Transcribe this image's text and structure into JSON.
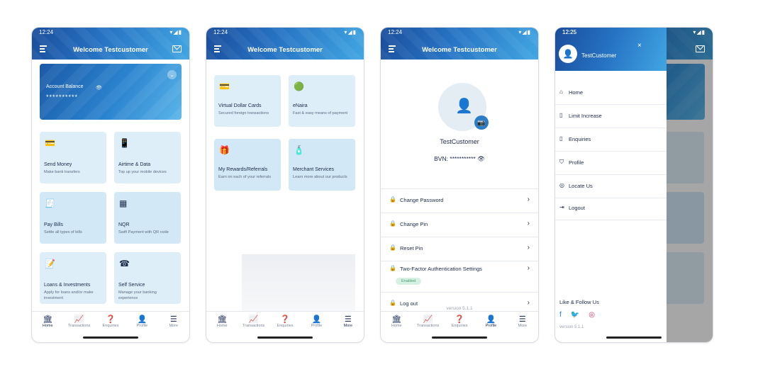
{
  "status": {
    "phone1_time": "12:24",
    "phone4_time": "12:25",
    "icons": "▾◢▮"
  },
  "header": {
    "title": "Welcome Testcustomer"
  },
  "home": {
    "balance_label": "Account Balance",
    "balance_value": "**********",
    "tiles": [
      {
        "title": "Send Money",
        "desc": "Make bank transfers",
        "icon": "wallet-icon"
      },
      {
        "title": "Airtime & Data",
        "desc": "Top up your mobile devices",
        "icon": "phone-icon"
      },
      {
        "title": "Pay Bills",
        "desc": "Settle all types of bills",
        "icon": "bill-icon"
      },
      {
        "title": "NQR",
        "desc": "Swift Payment with QR code",
        "icon": "qr-icon"
      },
      {
        "title": "Loans & Investments",
        "desc": "Apply for loans and/or make investment",
        "icon": "loan-icon"
      },
      {
        "title": "Self Service",
        "desc": "Manage your banking experience",
        "icon": "self-service-icon"
      }
    ]
  },
  "more": {
    "tiles": [
      {
        "title": "Virtual Dollar Cards",
        "desc": "Secured foreign transactions"
      },
      {
        "title": "eNaira",
        "desc": "Fast & easy means of payment"
      },
      {
        "title": "My Rewards/Referrals",
        "desc": "Earn on each of your referrals"
      },
      {
        "title": "Merchant Services",
        "desc": "Learn more about our products"
      }
    ]
  },
  "profile": {
    "name": "TestCustomer",
    "bvn": "BVN: ***********",
    "rows": [
      {
        "label": "Change Password"
      },
      {
        "label": "Change Pin"
      },
      {
        "label": "Reset Pin"
      },
      {
        "label": "Two-Factor Authentication Settings"
      },
      {
        "label": "Log out"
      }
    ],
    "badge": "Enabled",
    "version": "version 5.1.1"
  },
  "nav": [
    "Home",
    "Transactions",
    "Enquiries",
    "Profile",
    "More"
  ],
  "drawer": {
    "name": "TestCustomer",
    "items": [
      "Home",
      "Limit Increase",
      "Enquiries",
      "Profile",
      "Locate Us",
      "Logout"
    ],
    "follow": "Like & Follow Us",
    "version": "version 5.1.1"
  }
}
